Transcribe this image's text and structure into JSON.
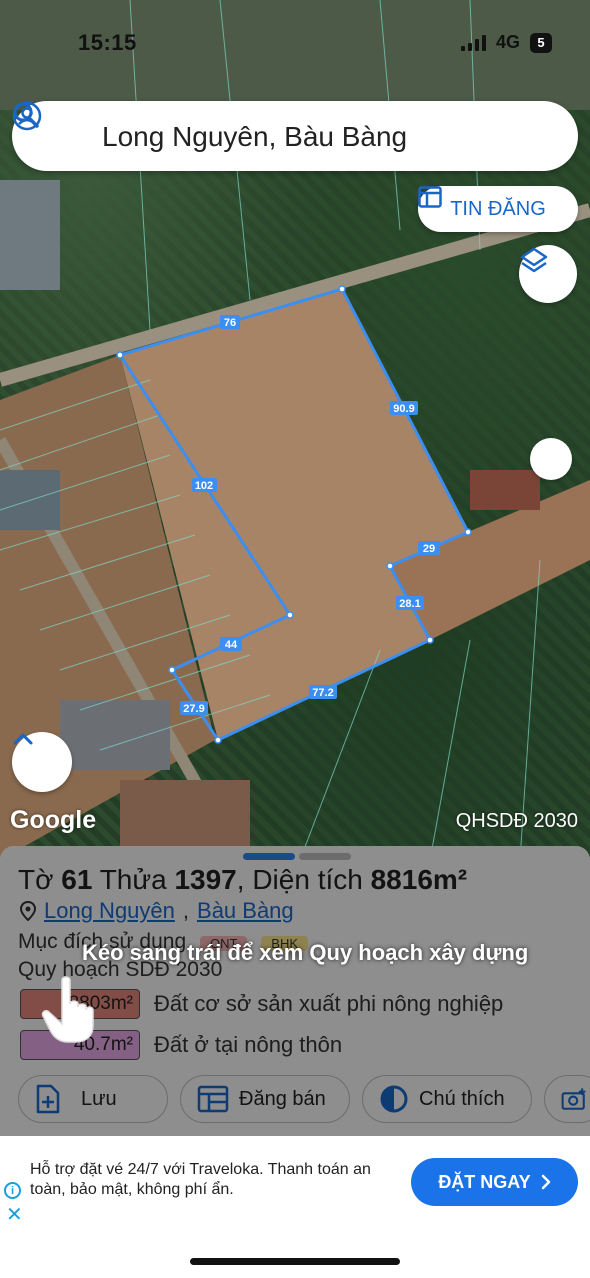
{
  "status_bar": {
    "time": "15:15",
    "network": "4G",
    "battery": "5"
  },
  "search": {
    "query": "Long Nguyên, Bàu Bàng"
  },
  "map": {
    "tin_dang_label": "TIN ĐĂNG",
    "watermark": "Google",
    "plan_label": "QHSDĐ 2030",
    "edge_labels": [
      "76",
      "90.9",
      "102",
      "29",
      "28.1",
      "44",
      "77.2",
      "27.9"
    ]
  },
  "sheet": {
    "title_prefix": "Tờ",
    "sheet_no": "61",
    "plot_prefix": "Thửa",
    "plot_no": "1397",
    "area_text": ", Diện tích",
    "area_value": "8816m²",
    "location_ward": "Long Nguyên",
    "location_sep": ",",
    "location_district": "Bàu Bàng",
    "purpose_label": "Mục đích sử dụng",
    "purpose_tags": [
      "ONT",
      "BHK"
    ],
    "plan_label": "Quy hoạch SDĐ 2030",
    "areas": [
      {
        "value": "8803m²",
        "desc": "Đất cơ sở sản xuất phi nông nghiệp",
        "color": "#e0867a"
      },
      {
        "value": "40.7m²",
        "desc": "Đất ở tại nông thôn",
        "color": "#e3a6e6"
      }
    ],
    "actions": [
      "Lưu",
      "Đăng bán",
      "Chú thích"
    ],
    "swipe_hint": "Kéo sang trái để xem Quy hoạch xây dựng"
  },
  "ad": {
    "text": "Hỗ trợ đặt vé 24/7 với Traveloka. Thanh toán an toàn, bảo mật, không phí ẩn.",
    "cta": "ĐẶT NGAY"
  },
  "colors": {
    "accent": "#1a73e8",
    "boundary": "#3c8ef0"
  }
}
